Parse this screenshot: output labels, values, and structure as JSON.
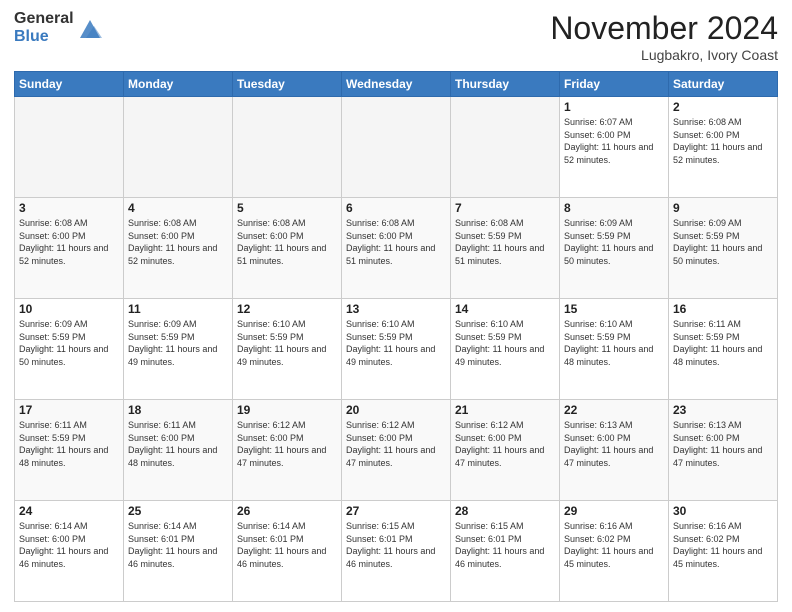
{
  "header": {
    "logo_general": "General",
    "logo_blue": "Blue",
    "month_title": "November 2024",
    "location": "Lugbakro, Ivory Coast"
  },
  "calendar": {
    "days_of_week": [
      "Sunday",
      "Monday",
      "Tuesday",
      "Wednesday",
      "Thursday",
      "Friday",
      "Saturday"
    ],
    "weeks": [
      [
        {
          "day": "",
          "empty": true
        },
        {
          "day": "",
          "empty": true
        },
        {
          "day": "",
          "empty": true
        },
        {
          "day": "",
          "empty": true
        },
        {
          "day": "",
          "empty": true
        },
        {
          "day": "1",
          "sunrise": "6:07 AM",
          "sunset": "6:00 PM",
          "daylight": "11 hours and 52 minutes."
        },
        {
          "day": "2",
          "sunrise": "6:08 AM",
          "sunset": "6:00 PM",
          "daylight": "11 hours and 52 minutes."
        }
      ],
      [
        {
          "day": "3",
          "sunrise": "6:08 AM",
          "sunset": "6:00 PM",
          "daylight": "11 hours and 52 minutes."
        },
        {
          "day": "4",
          "sunrise": "6:08 AM",
          "sunset": "6:00 PM",
          "daylight": "11 hours and 52 minutes."
        },
        {
          "day": "5",
          "sunrise": "6:08 AM",
          "sunset": "6:00 PM",
          "daylight": "11 hours and 51 minutes."
        },
        {
          "day": "6",
          "sunrise": "6:08 AM",
          "sunset": "6:00 PM",
          "daylight": "11 hours and 51 minutes."
        },
        {
          "day": "7",
          "sunrise": "6:08 AM",
          "sunset": "5:59 PM",
          "daylight": "11 hours and 51 minutes."
        },
        {
          "day": "8",
          "sunrise": "6:09 AM",
          "sunset": "5:59 PM",
          "daylight": "11 hours and 50 minutes."
        },
        {
          "day": "9",
          "sunrise": "6:09 AM",
          "sunset": "5:59 PM",
          "daylight": "11 hours and 50 minutes."
        }
      ],
      [
        {
          "day": "10",
          "sunrise": "6:09 AM",
          "sunset": "5:59 PM",
          "daylight": "11 hours and 50 minutes."
        },
        {
          "day": "11",
          "sunrise": "6:09 AM",
          "sunset": "5:59 PM",
          "daylight": "11 hours and 49 minutes."
        },
        {
          "day": "12",
          "sunrise": "6:10 AM",
          "sunset": "5:59 PM",
          "daylight": "11 hours and 49 minutes."
        },
        {
          "day": "13",
          "sunrise": "6:10 AM",
          "sunset": "5:59 PM",
          "daylight": "11 hours and 49 minutes."
        },
        {
          "day": "14",
          "sunrise": "6:10 AM",
          "sunset": "5:59 PM",
          "daylight": "11 hours and 49 minutes."
        },
        {
          "day": "15",
          "sunrise": "6:10 AM",
          "sunset": "5:59 PM",
          "daylight": "11 hours and 48 minutes."
        },
        {
          "day": "16",
          "sunrise": "6:11 AM",
          "sunset": "5:59 PM",
          "daylight": "11 hours and 48 minutes."
        }
      ],
      [
        {
          "day": "17",
          "sunrise": "6:11 AM",
          "sunset": "5:59 PM",
          "daylight": "11 hours and 48 minutes."
        },
        {
          "day": "18",
          "sunrise": "6:11 AM",
          "sunset": "6:00 PM",
          "daylight": "11 hours and 48 minutes."
        },
        {
          "day": "19",
          "sunrise": "6:12 AM",
          "sunset": "6:00 PM",
          "daylight": "11 hours and 47 minutes."
        },
        {
          "day": "20",
          "sunrise": "6:12 AM",
          "sunset": "6:00 PM",
          "daylight": "11 hours and 47 minutes."
        },
        {
          "day": "21",
          "sunrise": "6:12 AM",
          "sunset": "6:00 PM",
          "daylight": "11 hours and 47 minutes."
        },
        {
          "day": "22",
          "sunrise": "6:13 AM",
          "sunset": "6:00 PM",
          "daylight": "11 hours and 47 minutes."
        },
        {
          "day": "23",
          "sunrise": "6:13 AM",
          "sunset": "6:00 PM",
          "daylight": "11 hours and 47 minutes."
        }
      ],
      [
        {
          "day": "24",
          "sunrise": "6:14 AM",
          "sunset": "6:00 PM",
          "daylight": "11 hours and 46 minutes."
        },
        {
          "day": "25",
          "sunrise": "6:14 AM",
          "sunset": "6:01 PM",
          "daylight": "11 hours and 46 minutes."
        },
        {
          "day": "26",
          "sunrise": "6:14 AM",
          "sunset": "6:01 PM",
          "daylight": "11 hours and 46 minutes."
        },
        {
          "day": "27",
          "sunrise": "6:15 AM",
          "sunset": "6:01 PM",
          "daylight": "11 hours and 46 minutes."
        },
        {
          "day": "28",
          "sunrise": "6:15 AM",
          "sunset": "6:01 PM",
          "daylight": "11 hours and 46 minutes."
        },
        {
          "day": "29",
          "sunrise": "6:16 AM",
          "sunset": "6:02 PM",
          "daylight": "11 hours and 45 minutes."
        },
        {
          "day": "30",
          "sunrise": "6:16 AM",
          "sunset": "6:02 PM",
          "daylight": "11 hours and 45 minutes."
        }
      ]
    ]
  }
}
